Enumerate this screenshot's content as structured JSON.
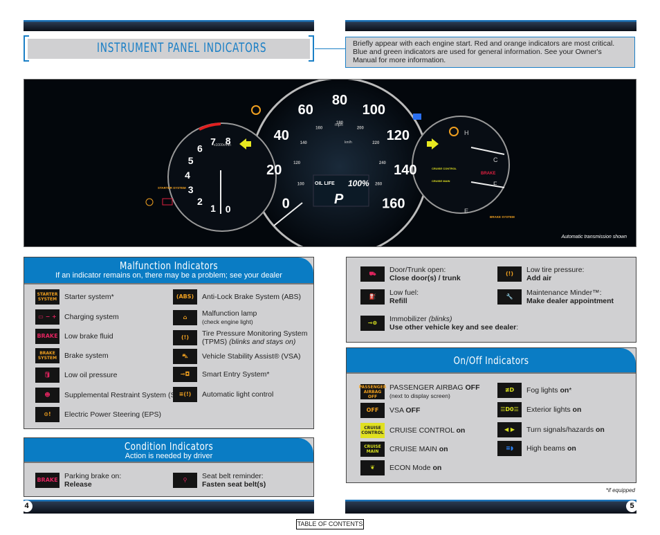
{
  "header": {
    "title": "INSTRUMENT PANEL INDICATORS",
    "description": "Briefly appear with each engine start. Red and orange indicators are most critical. Blue and green indicators are used for general information. See your Owner's Manual for more information."
  },
  "dashboard": {
    "speedometer": {
      "ticks": [
        0,
        20,
        40,
        60,
        80,
        100,
        120,
        140,
        160
      ],
      "unit": "mph",
      "unit2": "km/h",
      "km_ticks": [
        "100",
        "120",
        "140",
        "160",
        "180",
        "200",
        "220",
        "240",
        "260"
      ]
    },
    "tachometer": {
      "ticks": [
        "0",
        "1",
        "2",
        "3",
        "4",
        "5",
        "6",
        "7",
        "8"
      ],
      "unit": "x1000r/min"
    },
    "display": {
      "label": "OIL LIFE",
      "value": "100%",
      "gear": "P"
    },
    "temp_labels": {
      "hot": "H",
      "cold": "C"
    },
    "fuel_labels": {
      "full": "F",
      "empty": "E"
    },
    "warning_labels": {
      "brake": "BRAKE",
      "brake_system": "BRAKE SYSTEM",
      "starter": "STARTER SYSTEM",
      "cruise": "CRUISE CONTROL",
      "cruise_main": "CRUISE MAIN"
    },
    "caption": "Automatic transmission shown"
  },
  "malfunction": {
    "title": "Malfunction Indicators",
    "subtitle": "If an indicator remains on, there may be a problem; see your dealer",
    "left": [
      {
        "icon": "starter-system-icon",
        "glyph": "STARTER SYSTEM",
        "color": "#f0a020",
        "label": "Starter system*"
      },
      {
        "icon": "battery-icon",
        "glyph": "▭ − +",
        "color": "#e0245e",
        "label": "Charging system"
      },
      {
        "icon": "brake-icon",
        "glyph": "BRAKE",
        "color": "#e0245e",
        "label": "Low brake fluid"
      },
      {
        "icon": "brake-system-icon",
        "glyph": "BRAKE SYSTEM",
        "color": "#f0a020",
        "label": "Brake system"
      },
      {
        "icon": "oil-can-icon",
        "glyph": "🛢",
        "color": "#e0245e",
        "label": "Low oil pressure"
      },
      {
        "icon": "airbag-icon",
        "glyph": "☻",
        "color": "#e0245e",
        "label": "Supplemental Restraint System (SRS)"
      },
      {
        "icon": "steering-icon",
        "glyph": "⊙!",
        "color": "#f0a020",
        "label": "Electric Power Steering (EPS)"
      }
    ],
    "right": [
      {
        "icon": "abs-icon",
        "glyph": "(ABS)",
        "color": "#f0a020",
        "label": "Anti-Lock Brake System (ABS)"
      },
      {
        "icon": "check-engine-icon",
        "glyph": "⌂",
        "color": "#f0a020",
        "label": "Malfunction lamp",
        "sub": "(check engine light)"
      },
      {
        "icon": "tire-pressure-icon",
        "glyph": "(!)",
        "color": "#f0a020",
        "label": "Tire Pressure Monitoring System (TPMS)",
        "em": "(blinks and stays on)"
      },
      {
        "icon": "vsa-icon",
        "glyph": "⛍",
        "color": "#f0a020",
        "label": "Vehicle Stability Assist® (VSA)"
      },
      {
        "icon": "smart-key-icon",
        "glyph": "⊸◘",
        "color": "#f0a020",
        "label": "Smart Entry System*"
      },
      {
        "icon": "auto-light-icon",
        "glyph": "≡(!)",
        "color": "#f0a020",
        "label": "Automatic light control"
      }
    ]
  },
  "condition": {
    "title": "Condition Indicators",
    "subtitle": "Action is needed by driver",
    "items": [
      {
        "icon": "parking-brake-icon",
        "glyph": "BRAKE",
        "color": "#e0245e",
        "label": "Parking brake on:",
        "bold": "Release"
      },
      {
        "icon": "seatbelt-icon",
        "glyph": "⚲",
        "color": "#e0245e",
        "label": "Seat belt reminder:",
        "bold": "Fasten seat belt(s)"
      }
    ]
  },
  "info": {
    "left": [
      {
        "icon": "door-open-icon",
        "glyph": "⛟",
        "color": "#e0245e",
        "label": "Door/Trunk open:",
        "bold": "Close door(s) / trunk"
      },
      {
        "icon": "fuel-icon",
        "glyph": "⛽",
        "color": "#f0a020",
        "label": "Low fuel:",
        "bold": "Refill"
      },
      {
        "icon": "immobilizer-icon",
        "glyph": "⊸⊜",
        "color": "#d8e020",
        "label": "Immobilizer",
        "em": "(blinks)",
        "after": ":",
        "bold": "Use other vehicle key and see dealer"
      }
    ],
    "right": [
      {
        "icon": "low-tire-icon",
        "glyph": "(!)",
        "color": "#f0a020",
        "label": "Low tire pressure:",
        "bold": "Add air"
      },
      {
        "icon": "wrench-icon",
        "glyph": "🔧",
        "color": "#f0a020",
        "label": "Maintenance Minder™:",
        "bold": "Make dealer appointment"
      }
    ]
  },
  "onoff": {
    "title": "On/Off Indicators",
    "left": [
      {
        "icon": "passenger-airbag-off-icon",
        "glyph": "PASSENGER AIRBAG OFF",
        "color": "#f0a020",
        "label": "PASSENGER AIRBAG ",
        "bold": "OFF",
        "sub": "(next to display screen)"
      },
      {
        "icon": "vsa-off-icon",
        "glyph": "OFF",
        "color": "#f0a020",
        "label": "VSA ",
        "bold": "OFF"
      },
      {
        "icon": "cruise-control-icon",
        "glyph": "CRUISE CONTROL",
        "color": "#222",
        "bg": "#e0e020",
        "label": "CRUISE CONTROL ",
        "bold": "on"
      },
      {
        "icon": "cruise-main-icon",
        "glyph": "CRUISE MAIN",
        "color": "#d8e020",
        "label": "CRUISE MAIN ",
        "bold": "on"
      },
      {
        "icon": "econ-icon",
        "glyph": "❦",
        "color": "#d8e020",
        "label": "ECON Mode ",
        "bold": "on"
      }
    ],
    "right": [
      {
        "icon": "fog-light-icon",
        "glyph": "≢D",
        "color": "#d8e020",
        "label": "Fog lights ",
        "bold": "on",
        "after": "*"
      },
      {
        "icon": "exterior-lights-icon",
        "glyph": "☰D0☰",
        "color": "#d8e020",
        "label": "Exterior lights ",
        "bold": "on"
      },
      {
        "icon": "turn-signal-icon",
        "glyph": "◀ ▶",
        "color": "#d8e020",
        "label": "Turn signals/hazards ",
        "bold": "on"
      },
      {
        "icon": "high-beam-icon",
        "glyph": "≡◗",
        "color": "#2a7ff0",
        "label": "High beams ",
        "bold": "on"
      }
    ]
  },
  "footer": {
    "note": "*if equipped",
    "page_left": "4",
    "page_right": "5",
    "toc": "TABLE OF CONTENTS"
  }
}
